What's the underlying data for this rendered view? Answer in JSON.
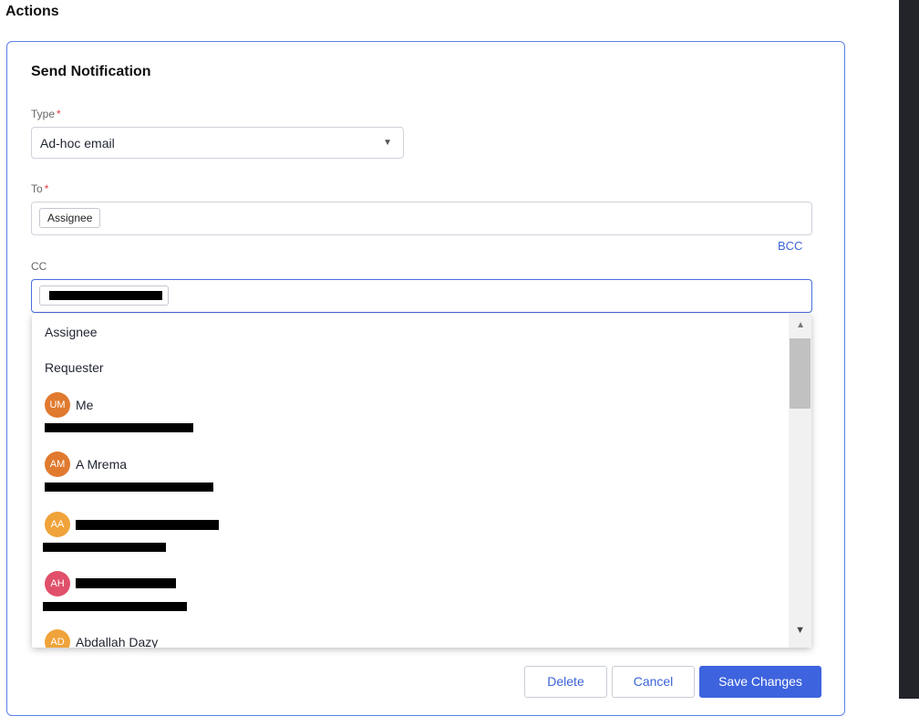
{
  "section_title": "Actions",
  "card": {
    "title": "Send Notification",
    "type_label": "Type",
    "type_value": "Ad-hoc email",
    "to_label": "To",
    "to_chip": "Assignee",
    "bcc_link": "BCC",
    "cc_label": "CC",
    "required_mark": "*"
  },
  "dropdown": {
    "options": [
      "Assignee",
      "Requester"
    ],
    "contacts": [
      {
        "initials": "UM",
        "name": "Me",
        "color": "#e07a2f"
      },
      {
        "initials": "AM",
        "name": "A Mrema",
        "color": "#e07a2f"
      },
      {
        "initials": "AA",
        "name": "",
        "color": "#f0a33a"
      },
      {
        "initials": "AH",
        "name": "",
        "color": "#e0506a"
      },
      {
        "initials": "AD",
        "name": "Abdallah Dazy",
        "color": "#f0a33a"
      }
    ]
  },
  "buttons": {
    "delete": "Delete",
    "cancel": "Cancel",
    "save": "Save Changes"
  },
  "colors": {
    "accent": "#3d63de",
    "required": "#e0393e"
  }
}
